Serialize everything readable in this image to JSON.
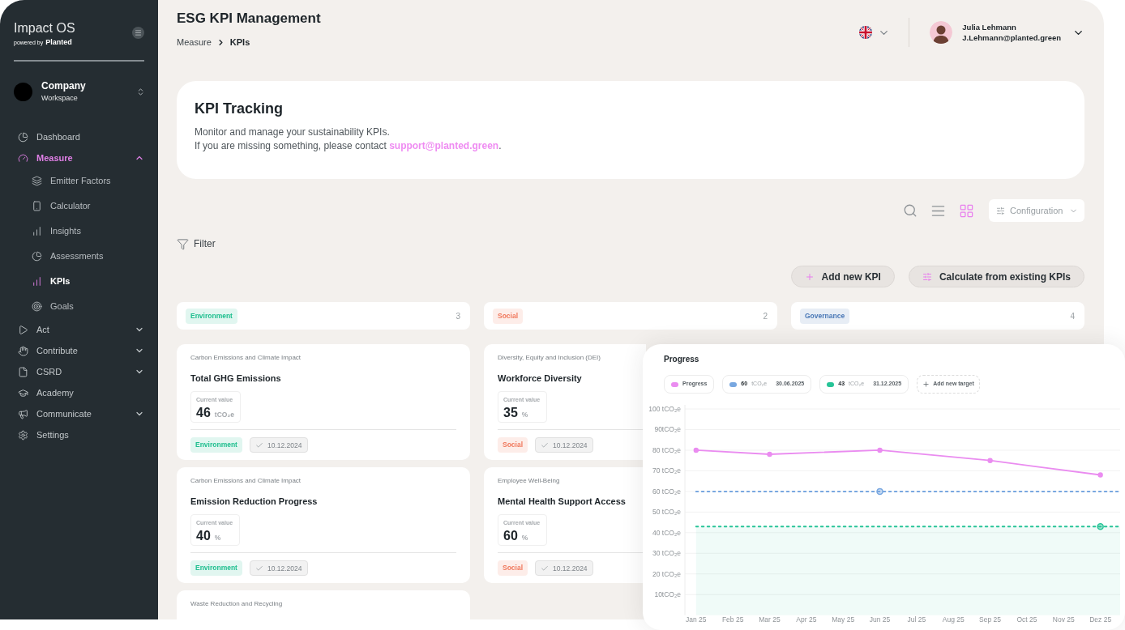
{
  "sidebar": {
    "brand": {
      "name": "Impact OS",
      "powered_by": "powered by",
      "logo": "Planted"
    },
    "workspace": {
      "name": "Company",
      "subtitle": "Workspace"
    },
    "nav": [
      {
        "label": "Dashboard",
        "selected": false
      },
      {
        "label": "Measure",
        "selected": true,
        "expanded": true,
        "children": [
          {
            "label": "Emitter Factors",
            "selected": false
          },
          {
            "label": "Calculator",
            "selected": false
          },
          {
            "label": "Insights",
            "selected": false
          },
          {
            "label": "Assessments",
            "selected": false
          },
          {
            "label": "KPIs",
            "selected": true
          },
          {
            "label": "Goals",
            "selected": false
          }
        ]
      },
      {
        "label": "Act",
        "selected": false,
        "expanded": false
      },
      {
        "label": "Contribute",
        "selected": false,
        "expanded": false
      },
      {
        "label": "CSRD",
        "selected": false,
        "expanded": false
      },
      {
        "label": "Academy",
        "selected": false
      },
      {
        "label": "Communicate",
        "selected": false,
        "expanded": false
      },
      {
        "label": "Settings",
        "selected": false
      }
    ]
  },
  "header": {
    "title": "ESG KPI Management",
    "breadcrumb": [
      "Measure",
      "KPIs"
    ],
    "user": {
      "name": "Julia Lehmann",
      "email": "J.Lehmann@planted.green"
    }
  },
  "intro": {
    "title": "KPI Tracking",
    "lines": [
      {
        "text": "Monitor and manage your sustainability KPIs."
      },
      {
        "text": "If you are missing something, please contact ",
        "link": "support@planted.green",
        "after": "."
      }
    ]
  },
  "toolbar": {
    "view_modes": [
      {
        "selected": false
      },
      {
        "selected": true
      }
    ],
    "configuration": "Configuration"
  },
  "filter": {
    "label": "Filter"
  },
  "actions": [
    {
      "label": "Add new KPI"
    },
    {
      "label": "Calculate from existing KPIs"
    }
  ],
  "board": {
    "columns": [
      {
        "tag": "Environment",
        "color": "#1fbf8f",
        "count": "3",
        "cards": [
          {
            "category": "Carbon Emissions and Climate Impact",
            "title": "Total GHG Emissions",
            "value_label": "Current value",
            "value": "46",
            "unit": "tCO₂e",
            "tag": "Environment",
            "date": "10.12.2024"
          },
          {
            "category": "Carbon Emissions and Climate Impact",
            "title": "Emission Reduction Progress",
            "value_label": "Current value",
            "value": "40",
            "unit": "%",
            "tag": "Environment",
            "date": "10.12.2024"
          },
          {
            "category": "Waste Reduction and Recycling"
          }
        ]
      },
      {
        "tag": "Social",
        "color": "#f0785c",
        "count": "2",
        "cards": [
          {
            "category": "Diversity, Equity and Inclusion (DEI)",
            "title": "Workforce Diversity",
            "value_label": "Current value",
            "value": "35",
            "unit": "%",
            "tag": "Social",
            "date": "10.12.2024"
          },
          {
            "category": "Employee Well-Being",
            "title": "Mental Health Support Access",
            "value_label": "Current value",
            "value": "60",
            "unit": "%",
            "tag": "Social",
            "date": "10.12.2024"
          }
        ]
      },
      {
        "tag": "Governance",
        "color": "#4a78b6",
        "count": "4"
      }
    ]
  },
  "progress_panel": {
    "title": "Progress",
    "legend": [
      {
        "kind": "series"
      },
      {
        "kind": "target",
        "value": "60",
        "unit": "tCO₂e"
      },
      {
        "kind": "target",
        "value": "43",
        "unit": "tCO₂e"
      },
      {
        "kind": "add",
        "label": "Add new target"
      }
    ],
    "chart_data": {
      "type": "line",
      "categories": [
        "Jan 25",
        "Feb 25",
        "Mar 25",
        "Apr 25",
        "May 25",
        "Jun 25",
        "Jul 25",
        "Aug 25",
        "Sep 25",
        "Oct 25",
        "Nov 25",
        "Dez 25"
      ],
      "series": [
        {
          "name": "Progress",
          "color": "#ea8cf0",
          "marker": "circle",
          "values": [
            80,
            null,
            78,
            null,
            null,
            80,
            null,
            null,
            75,
            null,
            null,
            68
          ]
        },
        {
          "name": "30.06.2025",
          "color": "#78a7e0",
          "marker": "circle",
          "values": [
            null,
            null,
            null,
            null,
            null,
            60,
            null,
            null,
            null,
            null,
            null,
            null
          ]
        },
        {
          "name": "31.12.2025",
          "color": "#27c497",
          "marker": "circle",
          "values": [
            null,
            null,
            null,
            null,
            null,
            null,
            null,
            null,
            null,
            null,
            null,
            43
          ]
        }
      ],
      "ylim": [
        0,
        100
      ],
      "yticks": [
        {
          "value": 100,
          "label": "100 tCO₂e"
        },
        {
          "value": 90,
          "label": "90tCO₂e"
        },
        {
          "value": 80,
          "label": "80 tCO₂e"
        },
        {
          "value": 70,
          "label": "70 tCO₂e"
        },
        {
          "value": 60,
          "label": "60 tCO₂e"
        },
        {
          "value": 50,
          "label": "50 tCO₂e"
        },
        {
          "value": 40,
          "label": "40 tCO₂e"
        },
        {
          "value": 30,
          "label": "30 tCO₂e"
        },
        {
          "value": 20,
          "label": "20 tCO₂e"
        },
        {
          "value": 10,
          "label": "10tCO₂e"
        }
      ],
      "grid": true,
      "ref_lines": [
        {
          "axis": "y",
          "value": 60,
          "color": "#78a7e0"
        },
        {
          "axis": "y",
          "value": 43,
          "color": "#27c497"
        }
      ],
      "bands": [
        {
          "axis": "y",
          "from": 0,
          "to": 43,
          "color": "#27c497"
        }
      ]
    }
  }
}
